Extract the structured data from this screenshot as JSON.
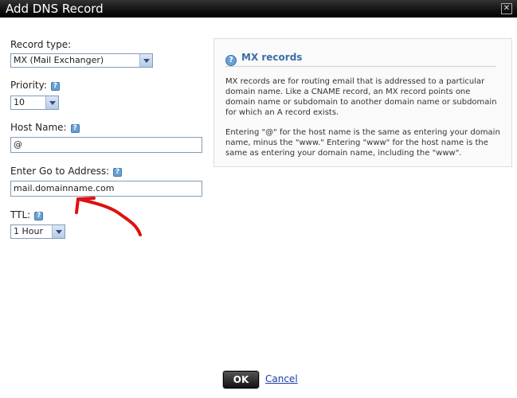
{
  "dialog": {
    "title": "Add DNS Record",
    "close_glyph": "✕"
  },
  "form": {
    "record_type_label": "Record type:",
    "record_type_value": "MX (Mail Exchanger)",
    "priority_label": "Priority:",
    "priority_value": "10",
    "host_name_label": "Host Name:",
    "host_name_value": "@",
    "goto_label": "Enter Go to Address:",
    "goto_value": "mail.domainname.com",
    "ttl_label": "TTL:",
    "ttl_value": "1 Hour",
    "help_glyph": "?"
  },
  "info": {
    "title": "MX records",
    "icon_glyph": "?",
    "para1": "MX records are for routing email that is addressed to a particular domain name. Like a CNAME record, an MX record points one domain name or subdomain to another domain name or subdomain for which an A record exists.",
    "para2": "Entering \"@\" for the host name is the same as entering your domain name, minus the \"www.\" Entering \"www\" for the host name is the same as entering your domain name, including the \"www\"."
  },
  "actions": {
    "ok_label": "OK",
    "cancel_label": "Cancel"
  },
  "colors": {
    "annotation_red": "#e01010",
    "link_blue": "#1a3ea8",
    "info_title_blue": "#3b6ea8"
  },
  "icons": [
    "help-icon",
    "close-icon",
    "question-circle-icon",
    "chevron-down-icon"
  ]
}
